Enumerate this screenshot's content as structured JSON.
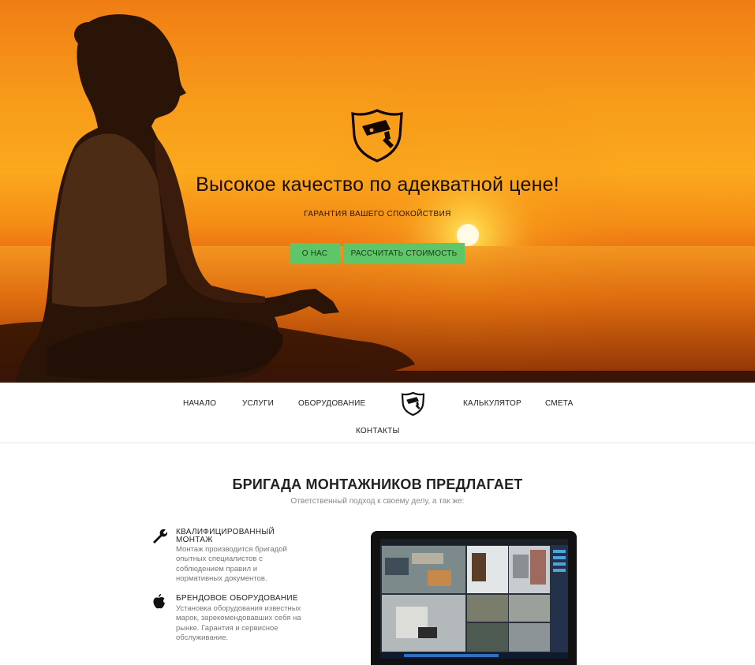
{
  "hero": {
    "title": "Высокое качество по адекватной цене!",
    "subtitle": "ГАРАНТИЯ ВАШЕГО СПОКОЙСТВИЯ",
    "button_about": "О НАС",
    "button_calculate": "РАССЧИТАТЬ СТОИМОСТЬ",
    "logo_icon": "security-camera-shield-icon"
  },
  "nav": {
    "items": [
      "НАЧАЛО",
      "УСЛУГИ",
      "ОБОРУДОВАНИЕ",
      "КАЛЬКУЛЯТОР",
      "СМЕТА",
      "КОНТАКТЫ"
    ],
    "logo_icon": "security-camera-shield-icon"
  },
  "section": {
    "title": "БРИГАДА МОНТАЖНИКОВ ПРЕДЛАГАЕТ",
    "subtitle": "Ответственный подход к своему делу, а так же:",
    "features": [
      {
        "icon": "wrench-icon",
        "title_line1": "КВАЛИФИЦИРОВАННЫЙ",
        "title_line2": "МОНТАЖ",
        "text": "Монтаж производится бригадой опытных специалистов с соблюдением правил и нормативных документов."
      },
      {
        "icon": "apple-icon",
        "title_line1": "БРЕНДОВОЕ ОБОРУДОВАНИЕ",
        "text": "Установка оборудования известных марок, зарекомендовавших себя на рынке. Гарантия и сервисное обслуживание."
      }
    ]
  },
  "colors": {
    "button_green": "#5ec569",
    "hero_orange": "#f79a1a",
    "text_dark": "#222222"
  }
}
